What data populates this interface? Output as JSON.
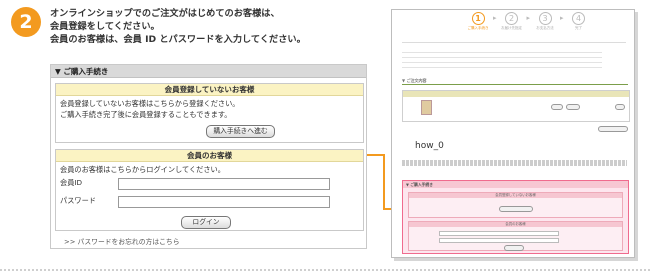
{
  "step": {
    "number": "2"
  },
  "instructions": [
    "オンラインショップでのご注文がはじめてのお客様は、",
    "会員登録をしてください。",
    "会員のお客様は、会員 ID とパスワードを入力してください。"
  ],
  "purchase_panel": {
    "title": "▼ ご購入手続き",
    "non_member": {
      "heading": "会員登録していないお客様",
      "line1": "会員登録していないお客様はこちらから登録ください。",
      "line2": "ご購入手続き完了後に会員登録することもできます。",
      "button": "購入手続きへ進む"
    },
    "member": {
      "heading": "会員のお客様",
      "intro": "会員のお客様はこちらからログインしてください。",
      "id_label": "会員ID",
      "password_label": "パスワード",
      "login_button": "ログイン",
      "forgot_link": ">> パスワードをお忘れの方はこちら"
    }
  },
  "thumbnail": {
    "caption": "how_0",
    "steps": [
      {
        "num": "1",
        "label": "ご購入手続き"
      },
      {
        "num": "2",
        "label": "お届け先指定"
      },
      {
        "num": "3",
        "label": "お支払方法"
      },
      {
        "num": "4",
        "label": "完了"
      }
    ],
    "cart_title": "▼ ご注文内容",
    "purchase_title": "▼ ご購入手続き",
    "member_heading": "会員のお客様",
    "non_member_heading": "会員登録していないお客様"
  },
  "colors": {
    "accent": "#f39a1f",
    "highlight_pink": "#fde6ee",
    "member_header": "#fbf3c3"
  }
}
